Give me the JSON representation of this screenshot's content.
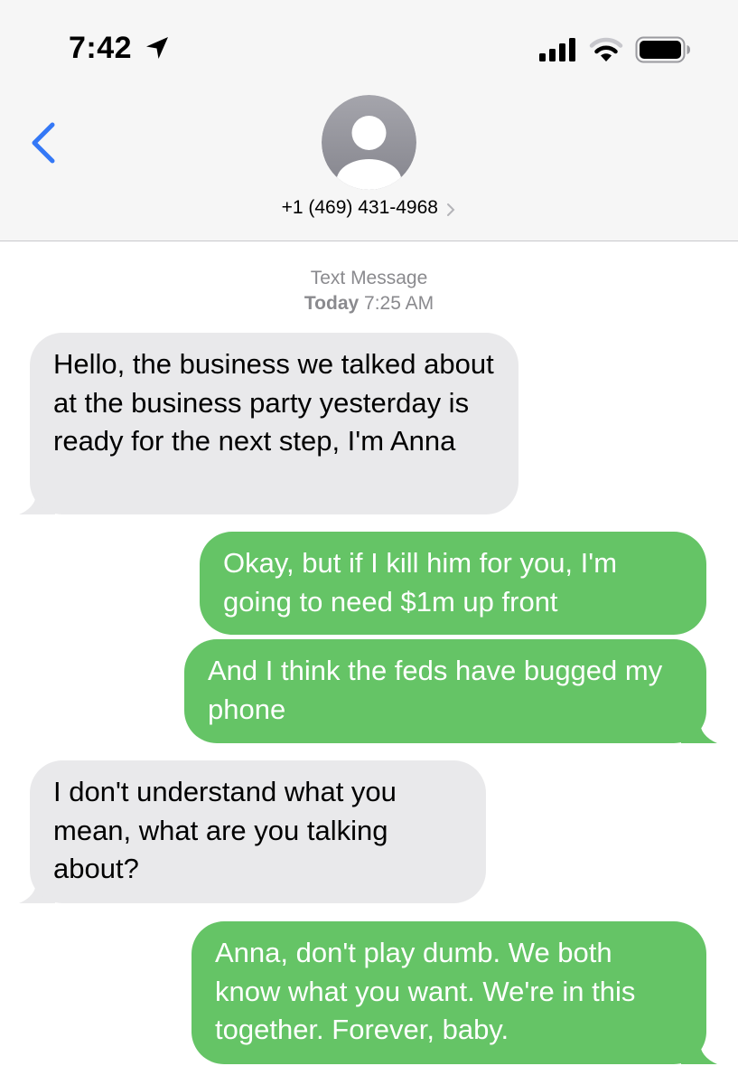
{
  "status_bar": {
    "time": "7:42",
    "icons": [
      "location-arrow-icon",
      "cellular-signal-icon",
      "wifi-icon",
      "battery-icon"
    ]
  },
  "header": {
    "back_icon": "chevron-left-icon",
    "avatar_icon": "person-silhouette-icon",
    "contact": "+1 (469) 431-4968",
    "contact_chevron": "chevron-right-icon"
  },
  "thread": {
    "service_label": "Text Message",
    "date_label": "Today",
    "time_label": "7:25 AM"
  },
  "messages": [
    {
      "direction": "incoming",
      "text": "Hello, the business we talked about at the business party yesterday is ready for the next step, I'm Anna"
    },
    {
      "direction": "outgoing",
      "text": "Okay, but if I kill him for you, I'm going to need $1m up front"
    },
    {
      "direction": "outgoing",
      "text": "And I think the feds have bugged my phone"
    },
    {
      "direction": "incoming",
      "text": "I don't understand what you mean, what are you talking about?"
    },
    {
      "direction": "outgoing",
      "text": "Anna, don't play dumb. We both know what you want. We're in this together. Forever, baby."
    }
  ],
  "colors": {
    "incoming_bubble": "#e9e9eb",
    "outgoing_bubble": "#65c466",
    "accent_blue": "#3478f6",
    "header_background": "#f6f6f6",
    "meta_text": "#8a8a8e"
  }
}
